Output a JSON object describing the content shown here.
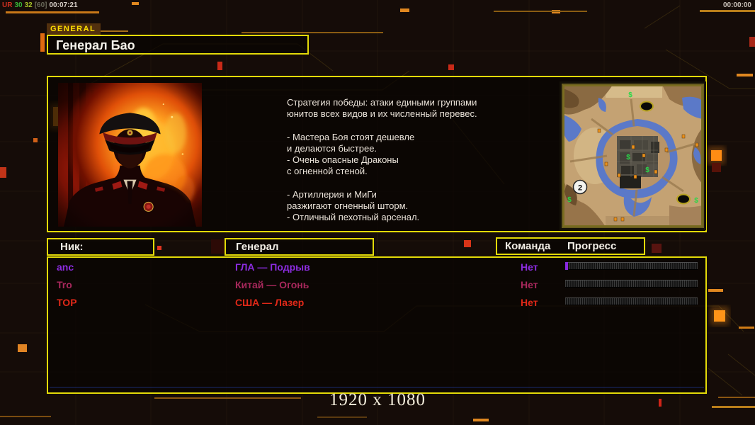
{
  "status_bar": {
    "label": "UR",
    "fps": "30",
    "value": "32",
    "bracket": "[60]",
    "session_time": "00:07:21",
    "clock": "00:00:00"
  },
  "tab_label": "GENERAL",
  "general_title": "Генерал Бао",
  "strategy_text": "Стратегия победы: атаки едиными группами\nюнитов всех видов и их численный перевес.\n\n- Мастера Боя стоят дешевле\nи делаются быстрее.\n- Очень опасные Драконы\nс огненной стеной.\n\n- Артиллерия и МиГи\nразжигают огненный шторм.\n- Отличный пехотный арсенал.",
  "minimap": {
    "start_marker_label": "2",
    "money_icon": "$"
  },
  "lobby_table": {
    "headers": {
      "nick": "Ник:",
      "general": "Генерал",
      "team": "Команда",
      "progress": "Прогресс"
    },
    "rows": [
      {
        "nick": "anc",
        "general": "ГЛА — Подрыв",
        "team": "Нет",
        "progress_percent": 2,
        "color": "#8c2ce0"
      },
      {
        "nick": "Tro",
        "general": "Китай — Огонь",
        "team": "Нет",
        "progress_percent": 0,
        "color": "#a8285c"
      },
      {
        "nick": "TOP",
        "general": "США — Лазер",
        "team": "Нет",
        "progress_percent": 0,
        "color": "#e02818"
      }
    ]
  },
  "footer": {
    "resolution": "1920 x 1080"
  },
  "colors": {
    "accent_yellow": "#e3da08",
    "decor_orange": "#e08820",
    "alert_red": "#d42818"
  }
}
